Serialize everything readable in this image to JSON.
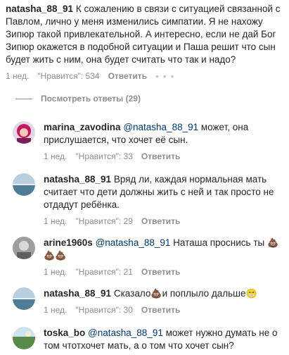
{
  "top_comment": {
    "username": "natasha_88_91",
    "text": "К сожалению в связи с ситуацией связанной с Павлом, лично у меня изменились симпатии. Я не нахожу Зипюр такой привлекательной. А интересно, если не дай Бог Зипюр окажется в подобной ситуации и Паша решит что сын будет жить с ним, она будет считать что так и надо?",
    "time": "1 нед.",
    "likes": "\"Нравится\": 534",
    "reply_label": "Ответить",
    "more_label": "• • •"
  },
  "view_replies_label": "Посмотреть ответы (29)",
  "replies": [
    {
      "username": "marina_zavodina",
      "mention": "@natasha_88_91",
      "text": "может, она прислушается, что хочет её сын.",
      "time": "1 нед.",
      "likes": "\"Нравится\": 33",
      "reply_label": "Ответить",
      "avatar": "pink-haired-woman"
    },
    {
      "username": "natasha_88_91",
      "text": "Вряд ли, каждая нормальная мать считает что дети должны жить с ней и так просто не отдадут ребёнка.",
      "time": "1 нед.",
      "likes": "\"Нравится\": 29",
      "reply_label": "Ответить",
      "avatar": "sea-landscape"
    },
    {
      "username": "arine1960s",
      "mention": "@natasha_88_91",
      "text": "Наташа проснись ты",
      "emojis": [
        "💩",
        "💩",
        "💩"
      ],
      "time": "1 нед.",
      "likes": "\"Нравится\": 21",
      "reply_label": "Ответить",
      "avatar": "gray-photo"
    },
    {
      "username": "natasha_88_91",
      "text_before": "Сказало",
      "text_after": "и поплыло дальше",
      "emoji_mid": "💩",
      "emoji_end": "😁",
      "time": "1 нед.",
      "likes": "\"Нравится\": 30",
      "reply_label": "Ответить",
      "avatar": "sea-landscape"
    },
    {
      "username": "toska_bo",
      "mention": "@natasha_88_91",
      "text": "может нужно думать не о том чтотхочет мать, а о том что хочет сын?",
      "avatar": "green-landscape"
    }
  ],
  "colors": {
    "username": "#262626",
    "mention": "#00376b",
    "meta": "#8e8e8e"
  }
}
